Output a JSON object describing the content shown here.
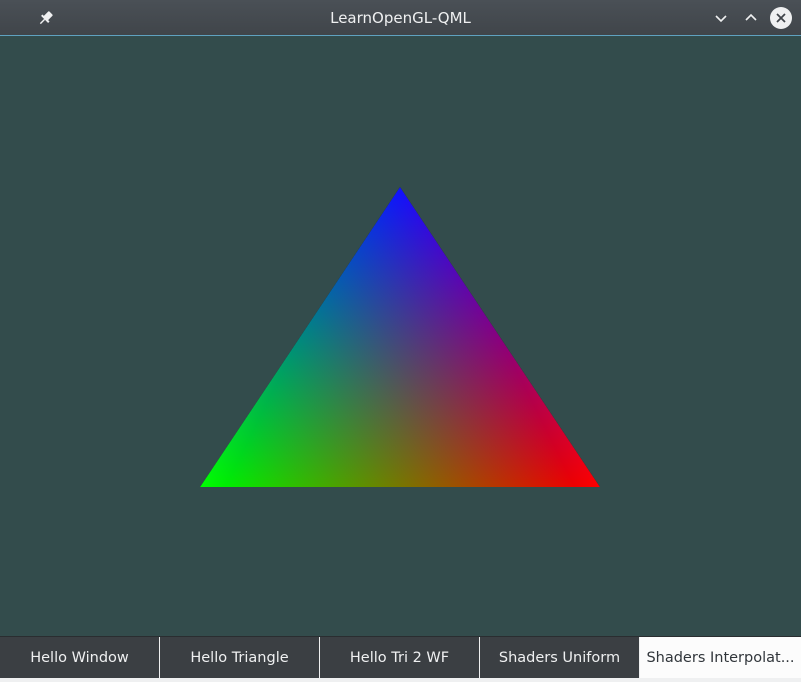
{
  "window": {
    "title": "LearnOpenGL-QML",
    "pin_icon": "pin-icon",
    "minimize_icon": "chevron-down-icon",
    "maximize_icon": "chevron-up-icon",
    "close_icon": "close-icon"
  },
  "colors": {
    "clear_color": "#334c4c",
    "vertex_top": "#0000ff",
    "vertex_left": "#00ff00",
    "vertex_right": "#ff0000"
  },
  "tabs": [
    {
      "label": "Hello Window",
      "active": false
    },
    {
      "label": "Hello Triangle",
      "active": false
    },
    {
      "label": "Hello Tri 2 WF",
      "active": false
    },
    {
      "label": "Shaders Uniform",
      "active": false
    },
    {
      "label": "Shaders Interpolat...",
      "active": true
    }
  ]
}
